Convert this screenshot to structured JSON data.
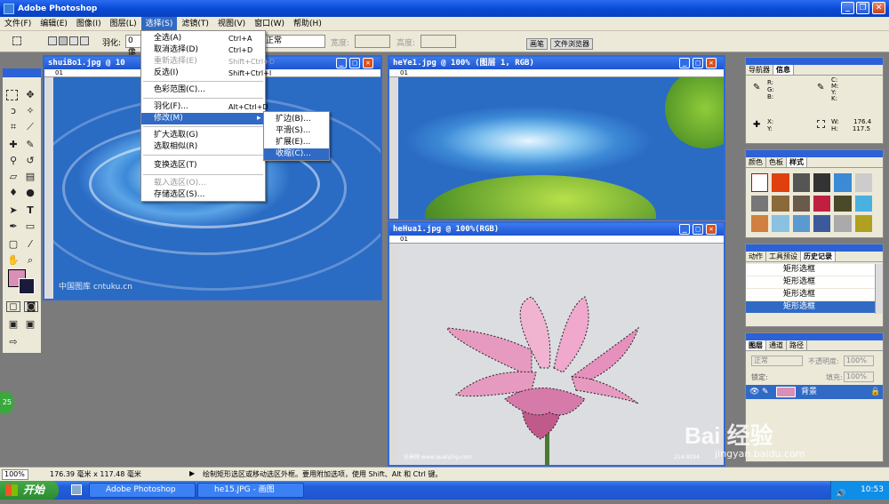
{
  "window": {
    "title": "Adobe Photoshop"
  },
  "menubar": [
    "文件(F)",
    "编辑(E)",
    "图像(I)",
    "图层(L)",
    "选择(S)",
    "滤镜(T)",
    "视图(V)",
    "窗口(W)",
    "帮助(H)"
  ],
  "options": {
    "feather_label": "羽化:",
    "feather_value": "0 像",
    "style_value": "正常",
    "width_label": "宽度:",
    "height_label": "高度:",
    "tab_brush": "画笔",
    "tab_browser": "文件浏览器"
  },
  "select_menu": [
    {
      "label": "全选(A)",
      "shortcut": "Ctrl+A"
    },
    {
      "label": "取消选择(D)",
      "shortcut": "Ctrl+D"
    },
    {
      "label": "重新选择(E)",
      "shortcut": "Shift+Ctrl+D"
    },
    {
      "label": "反选(I)",
      "shortcut": "Shift+Ctrl+I"
    },
    {
      "label": "色彩范围(C)..."
    },
    {
      "label": "羽化(F)...",
      "shortcut": "Alt+Ctrl+D"
    },
    {
      "label": "修改(M)"
    },
    {
      "label": "扩大选取(G)"
    },
    {
      "label": "选取相似(R)"
    },
    {
      "label": "变换选区(T)"
    },
    {
      "label": "载入选区(O)..."
    },
    {
      "label": "存储选区(S)..."
    }
  ],
  "modify_submenu": [
    "扩边(B)...",
    "平滑(S)...",
    "扩展(E)...",
    "收缩(C)..."
  ],
  "documents": {
    "doc1": {
      "title": "shuiBo1.jpg @ 10",
      "watermark": "中国图库 cntuku.cn",
      "corner": "01"
    },
    "doc2": {
      "title": "heYe1.jpg @ 100% (图层 1, RGB)",
      "corner": "01"
    },
    "doc3": {
      "title": "heHua1.jpg @ 100%(RGB)",
      "corner": "01",
      "credit": "全景网 www.quanjing.com",
      "code": "214-9294"
    }
  },
  "nav_panel": {
    "tabs": [
      "导航器",
      "信息"
    ],
    "info_labels": {
      "r": "R:",
      "g": "G:",
      "b": "B:",
      "c": "C:",
      "m": "M:",
      "y": "Y:",
      "k": "K:",
      "x": "X:",
      "yc": "Y:",
      "w": "W:",
      "h": "H:"
    },
    "w_value": "176.4",
    "h_value": "117.5"
  },
  "color_panel": {
    "tabs": [
      "颜色",
      "色板",
      "样式"
    ]
  },
  "history_panel": {
    "tabs": [
      "动作",
      "工具预设",
      "历史记录"
    ],
    "items": [
      "矩形选框",
      "矩形选框",
      "矩形选框",
      "矩形选框"
    ]
  },
  "layers_panel": {
    "tabs": [
      "图层",
      "通道",
      "路径"
    ],
    "mode": "正常",
    "opacity_label": "不透明度:",
    "opacity": "100%",
    "lock_label": "锁定:",
    "fill_label": "填充:",
    "fill": "100%",
    "layer_name": "背景"
  },
  "status": {
    "zoom": "100%",
    "size": "176.39 毫米 x 117.48 毫米",
    "hint": "绘制矩形选区或移动选区外框。要用附加选项，使用 Shift、Alt 和 Ctrl 键。"
  },
  "taskbar": {
    "start": "开始",
    "tasks": [
      "Adobe Photoshop",
      "he15.JPG - 画图"
    ],
    "clock": "10:53"
  },
  "badge": "25",
  "watermark": {
    "brand": "Bai 经验",
    "url": "jingyan.baidu.com"
  },
  "colors": {
    "accent": "#316ac5",
    "foreground": "#d98fb8",
    "background": "#1a1a3a"
  }
}
